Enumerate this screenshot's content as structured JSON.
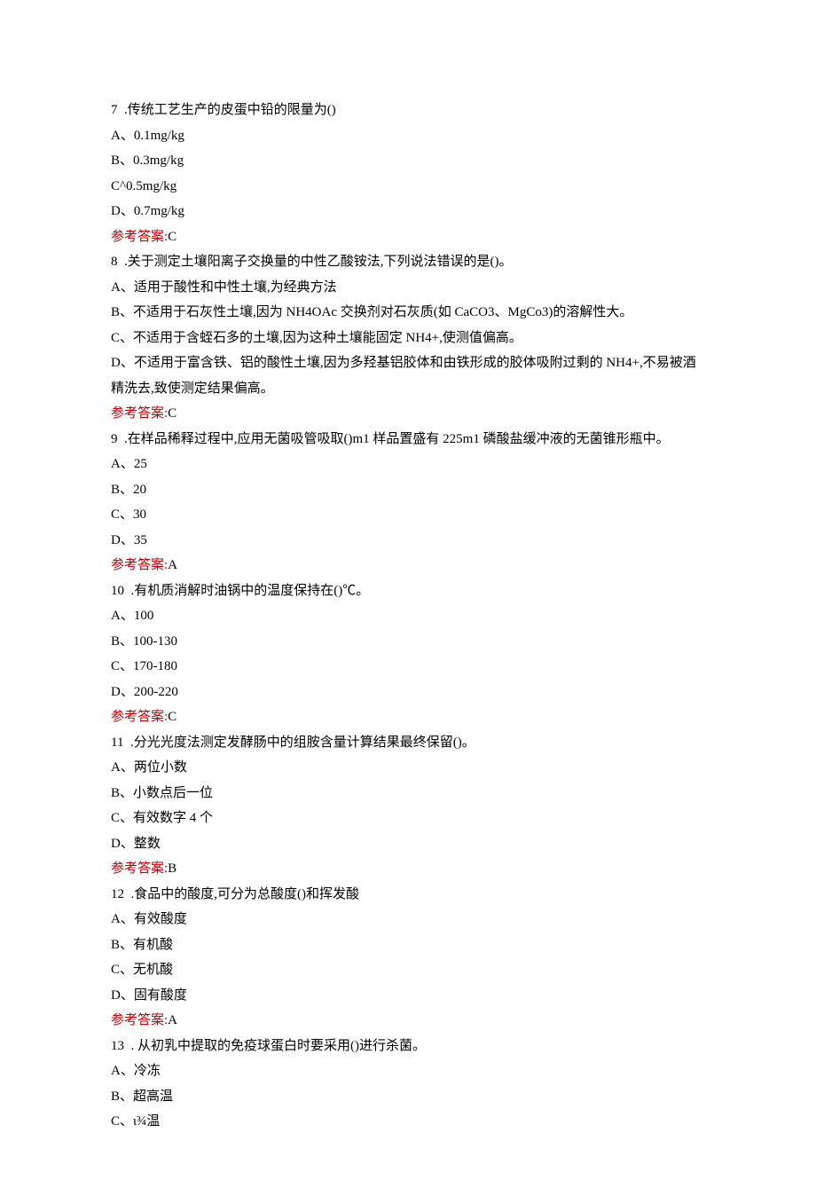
{
  "answer_label": "参考答案:",
  "questions": [
    {
      "num": "7",
      "gap": "  ",
      "stem": ".传统工艺生产的皮蛋中铅的限量为()",
      "options": [
        "A、0.1mg/kg",
        "B、0.3mg/kg",
        "C^0.5mg/kg",
        "D、0.7mg/kg"
      ],
      "answer": "C"
    },
    {
      "num": "8",
      "gap": "  ",
      "stem": ".关于测定土壤阳离子交换量的中性乙酸铵法,下列说法错误的是()。",
      "options": [
        "A、适用于酸性和中性土壤,为经典方法",
        "B、不适用于石灰性土壤,因为 NH4OAc 交换剂对石灰质(如 CaCO3、MgCo3)的溶解性大。",
        "C、不适用于含蛭石多的土壤,因为这种土壤能固定 NH4+,使测值偏高。",
        "D、不适用于富含铁、铝的酸性土壤,因为多羟基铝胶体和由铁形成的胶体吸附过剩的 NH4+,不易被酒精洗去,致使测定结果偏高。"
      ],
      "answer": "C"
    },
    {
      "num": "9",
      "gap": "  ",
      "stem": ".在样品稀释过程中,应用无菌吸管吸取()m1 样品置盛有 225m1 磷酸盐缓冲液的无菌锥形瓶中。",
      "options": [
        "A、25",
        "B、20",
        "C、30",
        "D、35"
      ],
      "answer": "A"
    },
    {
      "num": "10",
      "gap": "  ",
      "stem": ".有机质消解时油锅中的温度保持在()℃。",
      "options": [
        "A、100",
        "B、100-130",
        "C、170-180",
        "D、200-220"
      ],
      "answer": "C"
    },
    {
      "num": "11",
      "gap": "  ",
      "stem": ".分光光度法测定发酵肠中的组胺含量计算结果最终保留()。",
      "options": [
        "A、两位小数",
        "B、小数点后一位",
        "C、有效数字 4 个",
        "D、整数"
      ],
      "answer": "B"
    },
    {
      "num": "12",
      "gap": "  ",
      "stem": ".食品中的酸度,可分为总酸度()和挥发酸",
      "options": [
        "A、有效酸度",
        "B、有机酸",
        "C、无机酸",
        "D、固有酸度"
      ],
      "answer": "A"
    },
    {
      "num": "13",
      "gap": "  ",
      "stem": ". 从初乳中提取的免疫球蛋白时要采用()进行杀菌。",
      "options": [
        "A、冷冻",
        "B、超高温",
        "C、ι¾温"
      ],
      "answer": null
    }
  ]
}
